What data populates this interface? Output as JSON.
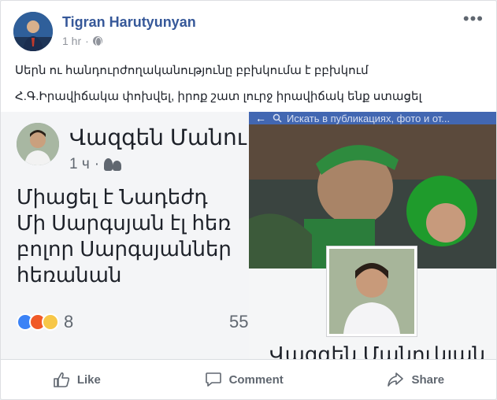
{
  "post": {
    "author": "Tigran Harutyunyan",
    "time": "1 hr",
    "privacy_icon": "globe-icon",
    "more_label": "•••",
    "line1": "Սերն ու հանդուրժողականությունը բբխկումա է բբխկում",
    "line2": "Հ.Գ.Իրավիճակա փոխվել, իրոք շատ լուրջ իրավիճակ ենք ստացել"
  },
  "shared": {
    "left": {
      "name": "Վազգեն Մանու",
      "time": "1 ч",
      "dot": "·",
      "audience_icon": "friends-icon",
      "body": [
        "Միացել է Նադեժդ",
        "Մի Սարգսյան էլ հեռ",
        "բոլոր Սարգսյաններ",
        "հեռանան"
      ],
      "reaction_count": "8",
      "right_count": "55"
    },
    "right": {
      "search_placeholder": "Искать в публикациях, фото и от...",
      "name": "Վազգեն Մանուկյան"
    }
  },
  "actions": {
    "like": "Like",
    "comment": "Comment",
    "share": "Share"
  },
  "colors": {
    "link": "#365899",
    "fb_blue": "#4267b2",
    "muted": "#90949c"
  }
}
